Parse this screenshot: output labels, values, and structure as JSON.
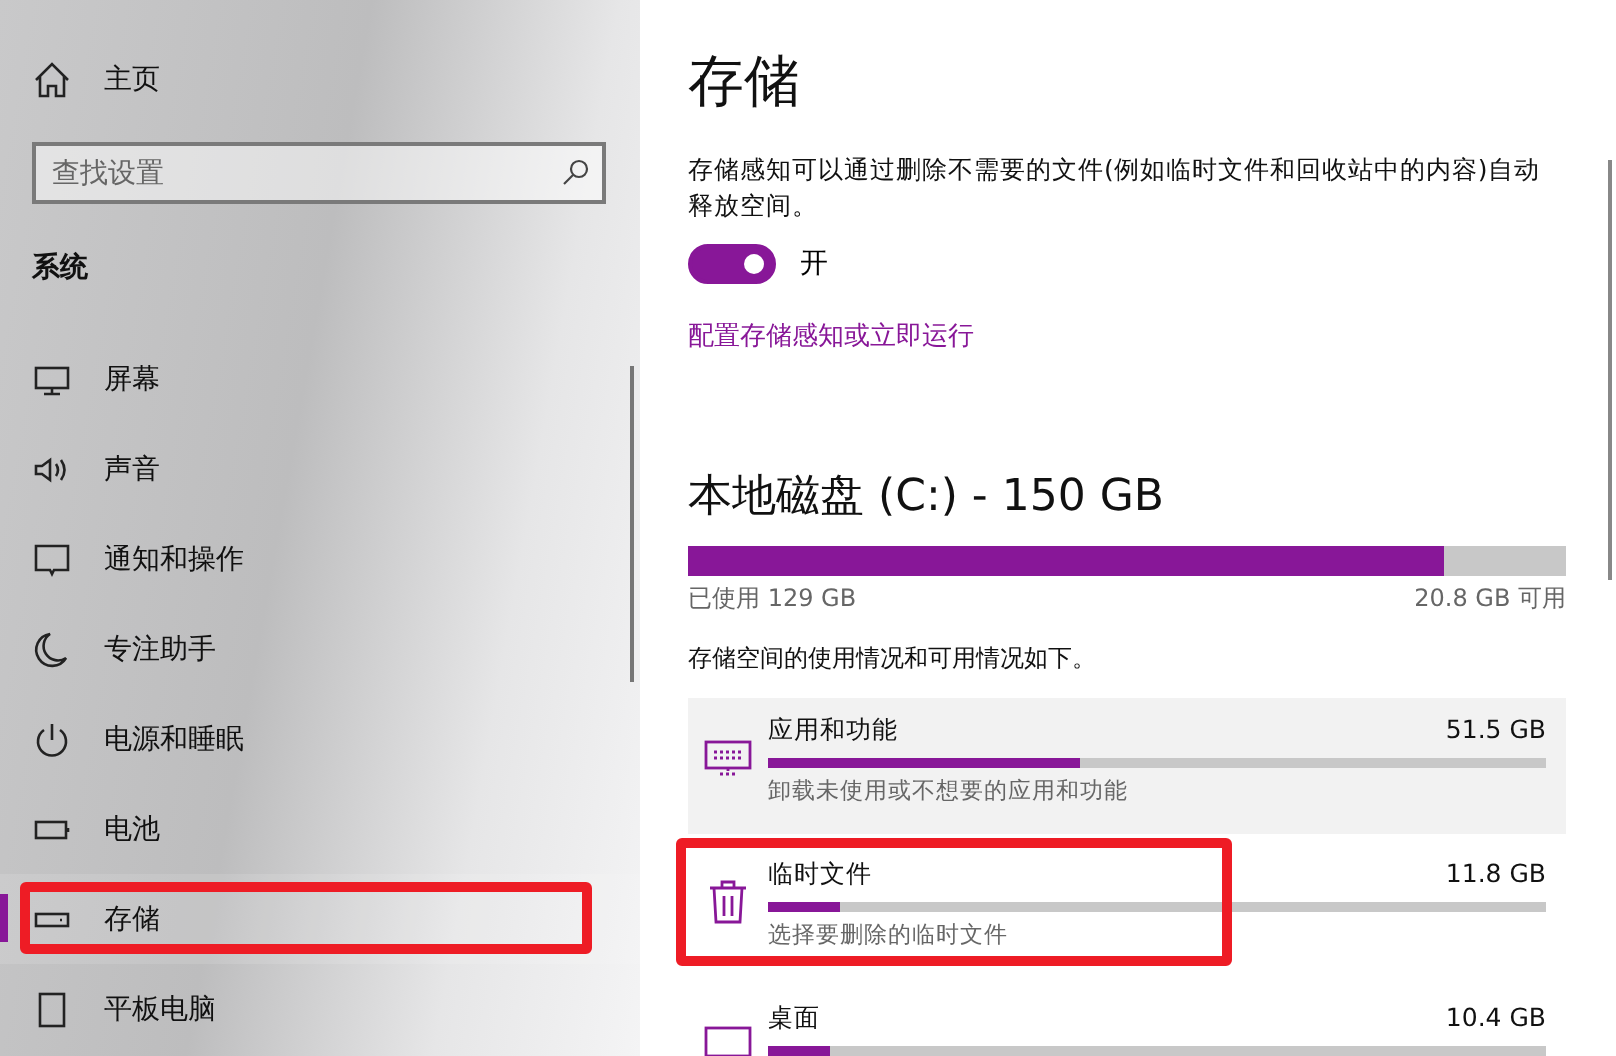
{
  "sidebar": {
    "home": "主页",
    "search": {
      "placeholder": "查找设置"
    },
    "section": "系统",
    "items": [
      {
        "label": "屏幕",
        "kind": "display",
        "selected": false,
        "highlighted": false
      },
      {
        "label": "声音",
        "kind": "sound",
        "selected": false,
        "highlighted": false
      },
      {
        "label": "通知和操作",
        "kind": "notify",
        "selected": false,
        "highlighted": false
      },
      {
        "label": "专注助手",
        "kind": "moon",
        "selected": false,
        "highlighted": false
      },
      {
        "label": "电源和睡眠",
        "kind": "power",
        "selected": false,
        "highlighted": false
      },
      {
        "label": "电池",
        "kind": "battery",
        "selected": false,
        "highlighted": false
      },
      {
        "label": "存储",
        "kind": "drive",
        "selected": true,
        "highlighted": true
      },
      {
        "label": "平板电脑",
        "kind": "tablet",
        "selected": false,
        "highlighted": false
      }
    ]
  },
  "main": {
    "title": "存储",
    "description": "存储感知可以通过删除不需要的文件(例如临时文件和回收站中的内容)自动释放空间。",
    "toggle": {
      "on": true,
      "label": "开"
    },
    "link": "配置存储感知或立即运行",
    "disk": {
      "title": "本地磁盘 (C:) - 150 GB",
      "level": 0.86,
      "used": "已使用 129 GB",
      "free": "20.8 GB 可用"
    },
    "usage_note": "存储空间的使用情况和可用情况如下。",
    "categories": [
      {
        "name": "应用和功能",
        "kind": "apps",
        "size": "51.5 GB",
        "level": 0.4,
        "hint": "卸载未使用或不想要的应用和功能",
        "hovered": true,
        "highlighted": false
      },
      {
        "name": "临时文件",
        "kind": "trash",
        "size": "11.8 GB",
        "level": 0.092,
        "hint": "选择要删除的临时文件",
        "hovered": false,
        "highlighted": true
      },
      {
        "name": "桌面",
        "kind": "desktop",
        "size": "10.4 GB",
        "level": 0.08,
        "hovered": false,
        "highlighted": false
      }
    ]
  }
}
